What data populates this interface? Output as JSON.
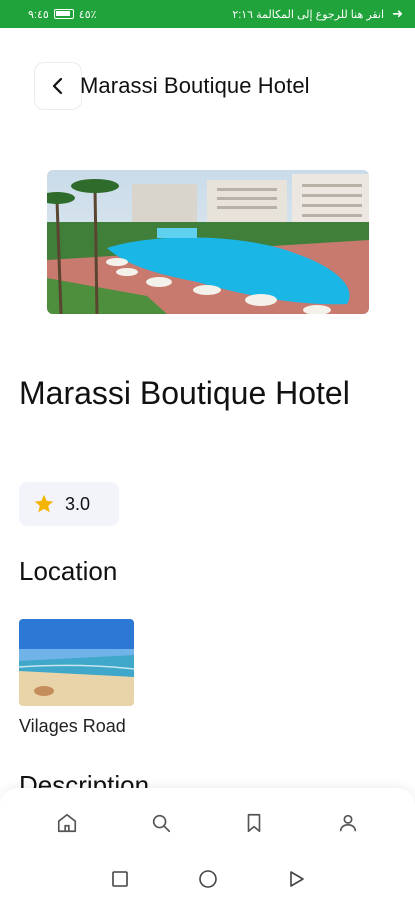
{
  "status_bar": {
    "time": "٩:٤٥",
    "battery": "٤٥٪",
    "call_text": "انقر هنا للرجوع إلى المكالمة ٢:١٦",
    "bg_color": "#1fa33a"
  },
  "header": {
    "back_icon": "chevron-left-icon",
    "title": "Marassi Boutique Hotel"
  },
  "hotel": {
    "name": "Marassi Boutique Hotel",
    "rating": "3.0"
  },
  "location": {
    "section_title": "Location",
    "name": "Vilages Road"
  },
  "description": {
    "section_title": "Description"
  },
  "bottom_nav": {
    "items": [
      "home-icon",
      "search-icon",
      "bookmark-icon",
      "profile-icon"
    ]
  },
  "system_nav": {
    "items": [
      "recents-icon",
      "home-circle-icon",
      "back-triangle-icon"
    ]
  },
  "colors": {
    "accent": "#1fa33a",
    "star": "#f5b400",
    "pool": "#19b6e6"
  }
}
